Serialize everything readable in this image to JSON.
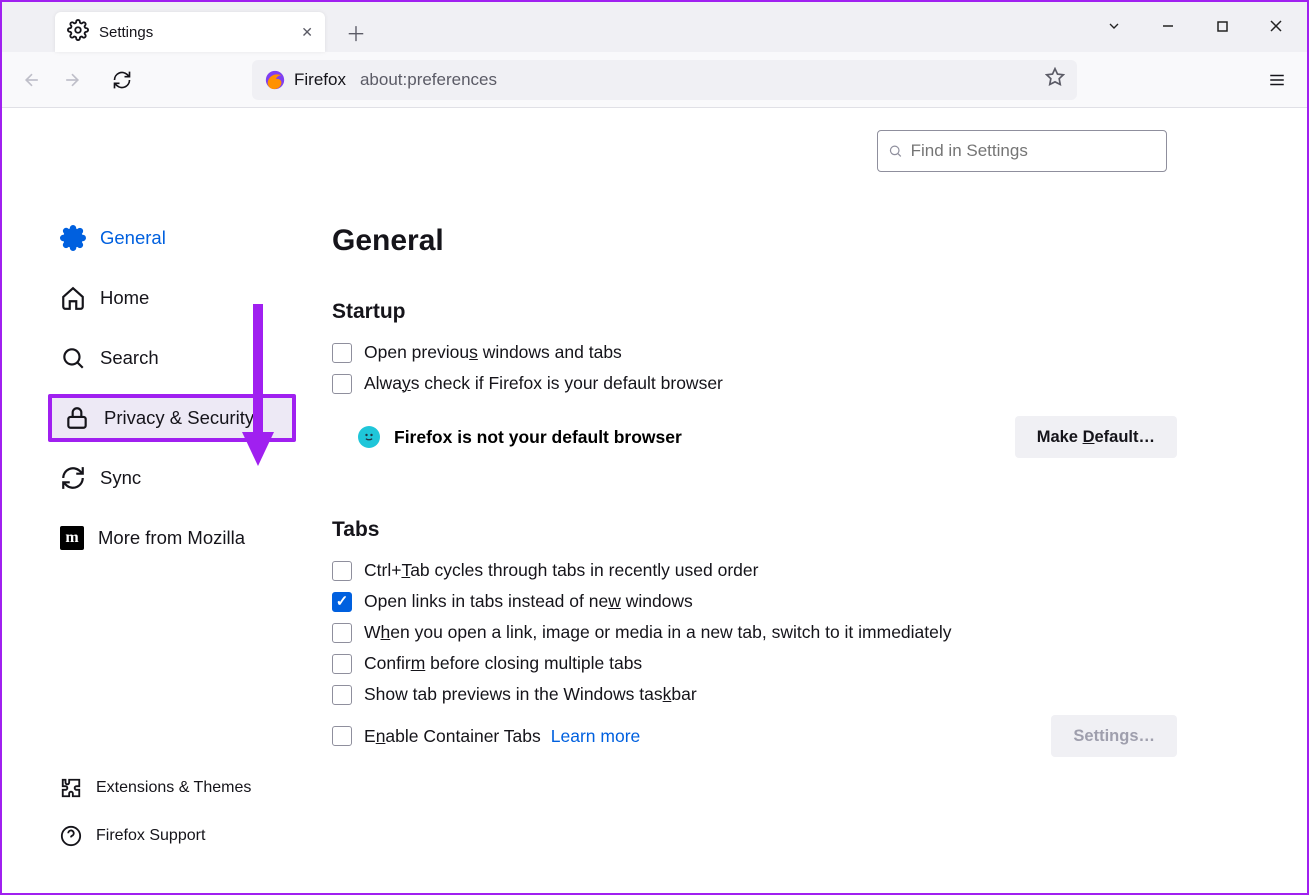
{
  "browser_tab": {
    "title": "Settings"
  },
  "urlbar": {
    "identity_label": "Firefox",
    "address": "about:preferences"
  },
  "search": {
    "placeholder": "Find in Settings"
  },
  "sidebar": {
    "items": [
      {
        "label": "General"
      },
      {
        "label": "Home"
      },
      {
        "label": "Search"
      },
      {
        "label": "Privacy & Security"
      },
      {
        "label": "Sync"
      },
      {
        "label": "More from Mozilla"
      }
    ],
    "bottom": [
      {
        "label": "Extensions & Themes"
      },
      {
        "label": "Firefox Support"
      }
    ]
  },
  "main": {
    "title": "General",
    "startup": {
      "heading": "Startup",
      "open_previous_pre": "Open previou",
      "open_previous_u": "s",
      "open_previous_post": " windows and tabs",
      "always_check_pre": "Alwa",
      "always_check_u": "y",
      "always_check_post": "s check if Firefox is your default browser",
      "not_default_msg": "Firefox is not your default browser",
      "make_default_pre": "Make ",
      "make_default_u": "D",
      "make_default_post": "efault…"
    },
    "tabs": {
      "heading": "Tabs",
      "ctrltab_pre": "Ctrl+",
      "ctrltab_u": "T",
      "ctrltab_post": "ab cycles through tabs in recently used order",
      "open_links_pre": "Open links in tabs instead of ne",
      "open_links_u": "w",
      "open_links_post": " windows",
      "switch_pre": "W",
      "switch_u": "h",
      "switch_post": "en you open a link, image or media in a new tab, switch to it immediately",
      "confirm_pre": "Confir",
      "confirm_u": "m",
      "confirm_post": " before closing multiple tabs",
      "previews_pre": "Show tab previews in the Windows tas",
      "previews_u": "k",
      "previews_post": "bar",
      "container_pre": "E",
      "container_u": "n",
      "container_post": "able Container Tabs",
      "learn_more": "Learn more",
      "settings_btn": "Settings…"
    }
  }
}
